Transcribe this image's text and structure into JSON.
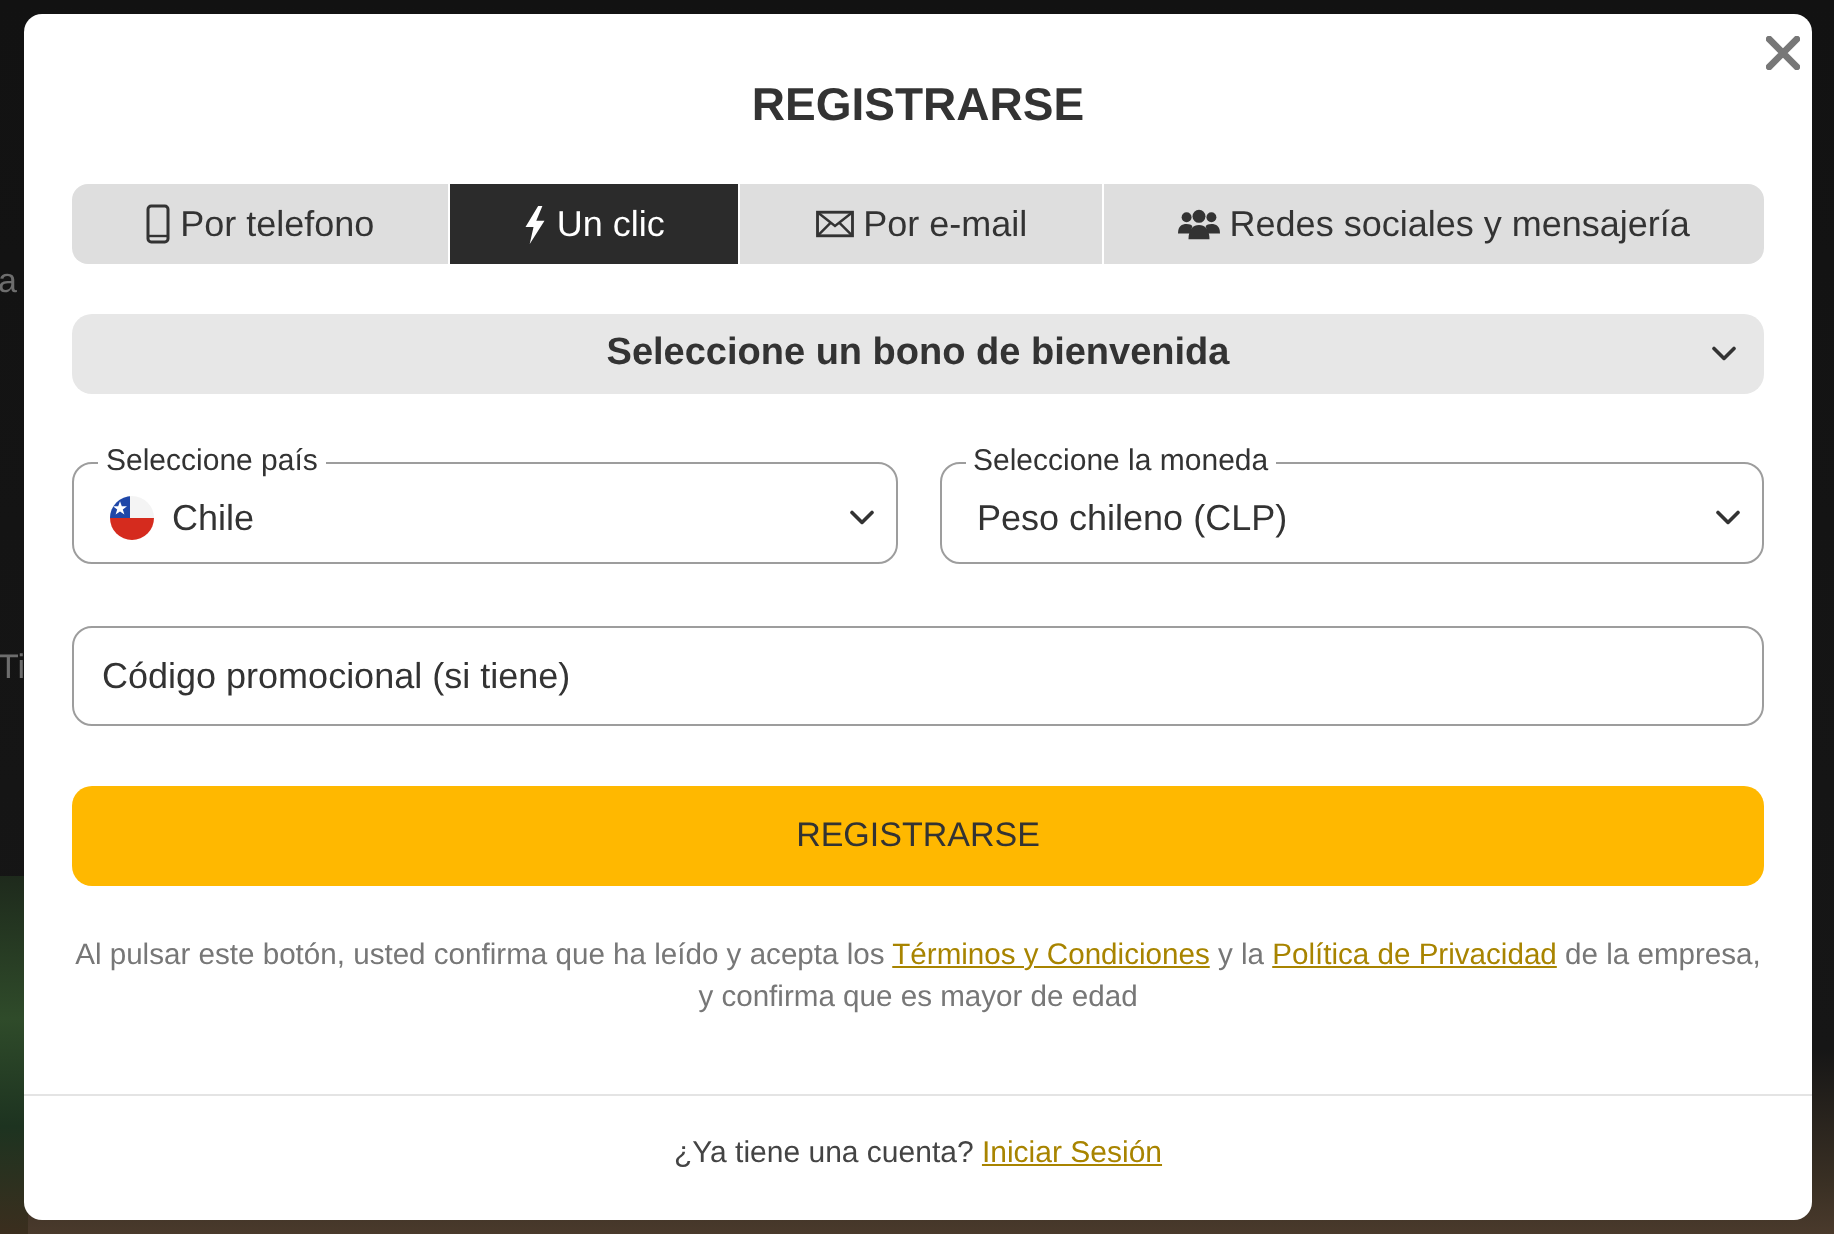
{
  "backdrop": {
    "fragments": [
      "a",
      "Ti"
    ]
  },
  "dialog": {
    "title": "REGISTRARSE"
  },
  "tabs": [
    {
      "label": "Por telefono",
      "kind": "phone",
      "selected": false
    },
    {
      "label": "Un clic",
      "kind": "flash",
      "selected": true
    },
    {
      "label": "Por e-mail",
      "kind": "mail",
      "selected": false
    },
    {
      "label": "Redes sociales y mensajería",
      "kind": "social",
      "selected": false
    }
  ],
  "bonus_select": {
    "label": "Seleccione un bono de bienvenida"
  },
  "country_select": {
    "label": "Seleccione país",
    "value": "Chile"
  },
  "currency_select": {
    "label": "Seleccione la moneda",
    "value": "Peso chileno (CLP)"
  },
  "promo_field": {
    "placeholder": "Código promocional (si tiene)"
  },
  "submit_button": {
    "label": "REGISTRARSE"
  },
  "legal_text": [
    {
      "kind": "text",
      "text": "Al pulsar este botón, usted confirma que ha leído y acepta los "
    },
    {
      "kind": "link",
      "text": "Términos y Condiciones"
    },
    {
      "kind": "text",
      "text": " y la "
    },
    {
      "kind": "link",
      "text": "Política de Privacidad"
    },
    {
      "kind": "text",
      "text": " de la empresa, y confirma que es mayor de edad"
    }
  ],
  "signin_prompt": [
    {
      "kind": "text",
      "text": "¿Ya tiene una cuenta? "
    },
    {
      "kind": "link",
      "text": "Iniciar Sesión"
    }
  ]
}
